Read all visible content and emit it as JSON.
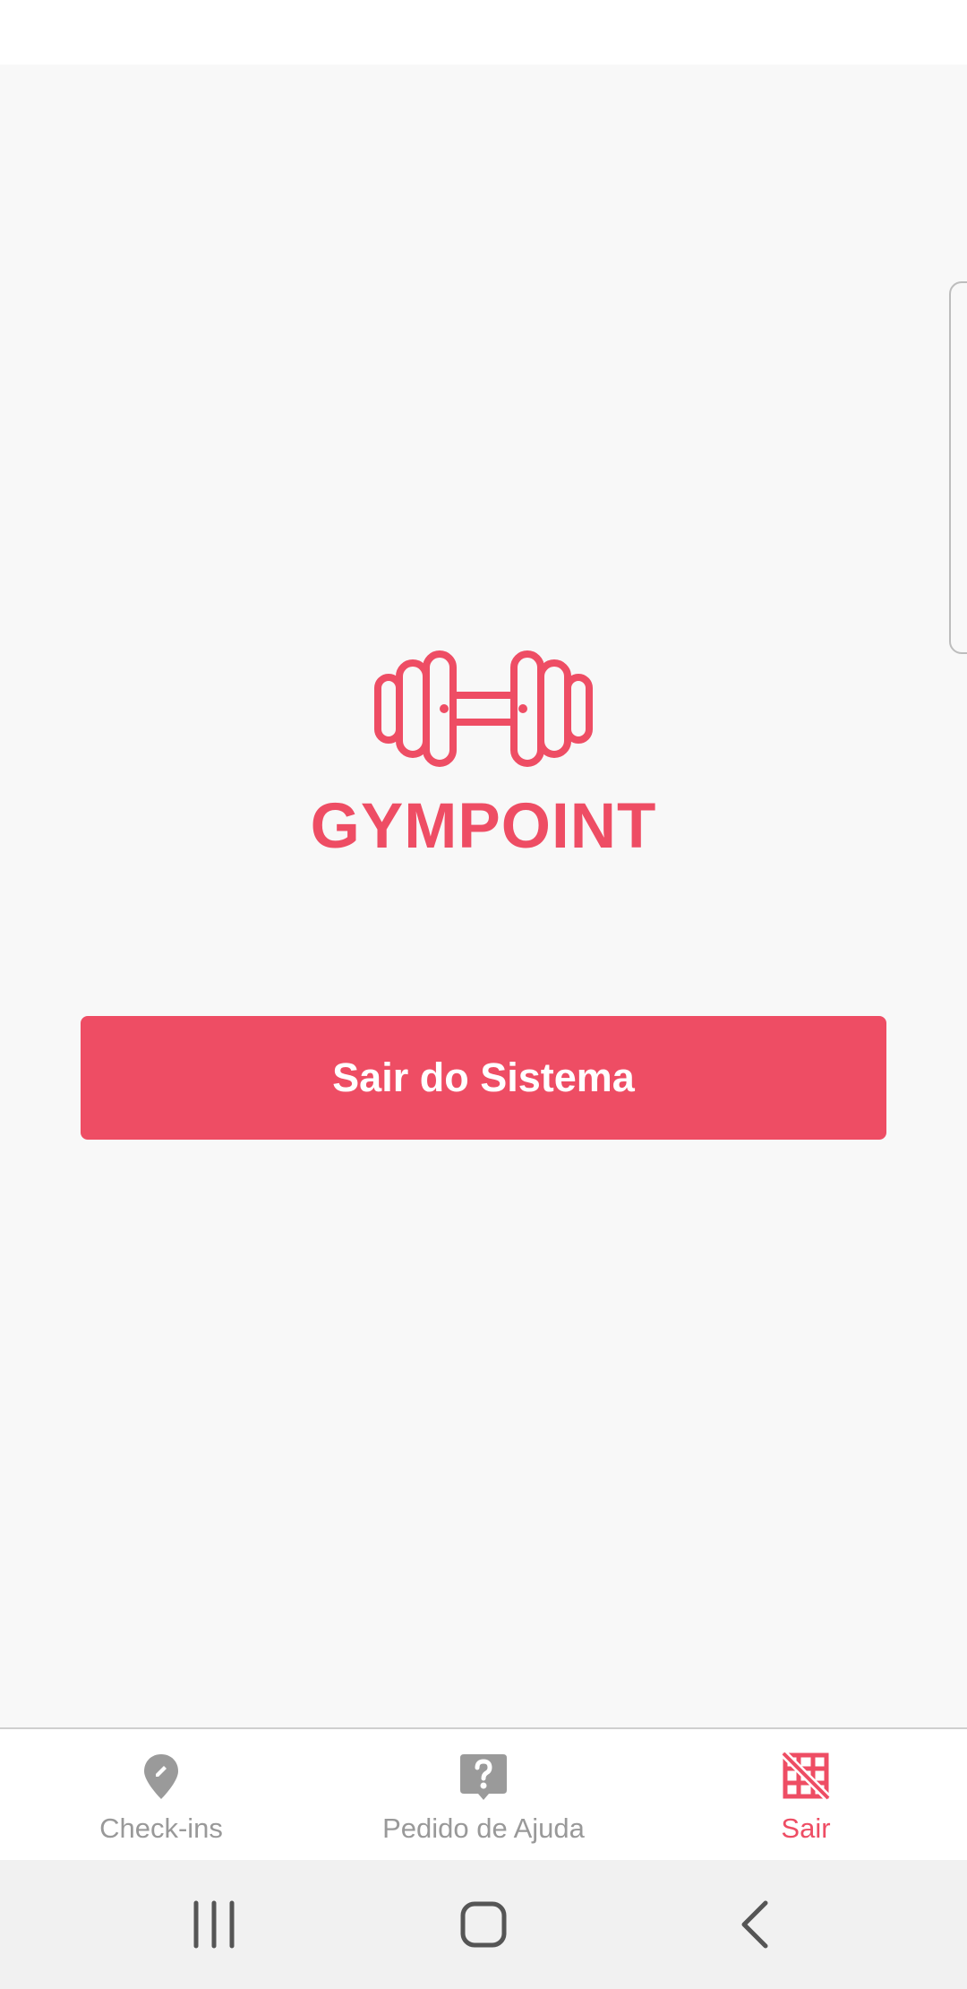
{
  "brand": {
    "title": "GYMPOINT",
    "logo_icon": "dumbbell-icon",
    "color": "#ee4d64"
  },
  "main": {
    "logout_button_label": "Sair do Sistema"
  },
  "tabs": [
    {
      "label": "Check-ins",
      "icon": "map-pin-edit-icon",
      "active": false
    },
    {
      "label": "Pedido de Ajuda",
      "icon": "help-bubble-icon",
      "active": false
    },
    {
      "label": "Sair",
      "icon": "grid-off-icon",
      "active": true
    }
  ],
  "colors": {
    "accent": "#ee4d64",
    "inactive": "#999999",
    "background": "#f8f8f8"
  },
  "system_nav": {
    "buttons": [
      "recent-apps-icon",
      "home-icon",
      "back-icon"
    ]
  }
}
